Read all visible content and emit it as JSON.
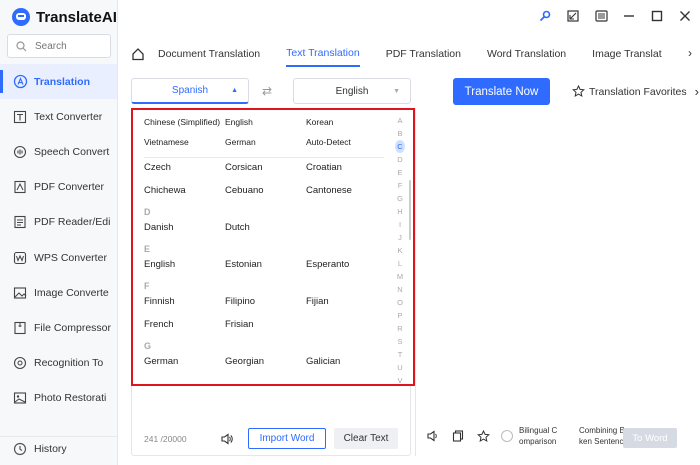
{
  "app": {
    "name": "TranslateAI"
  },
  "search": {
    "placeholder": "Search"
  },
  "sidebar": {
    "items": [
      {
        "label": "Translation",
        "icon": "translate-icon",
        "active": true
      },
      {
        "label": "Text Converter",
        "icon": "text-converter-icon"
      },
      {
        "label": "Speech Convert",
        "icon": "speech-icon"
      },
      {
        "label": "PDF Converter",
        "icon": "pdf-icon"
      },
      {
        "label": "PDF Reader/Edi",
        "icon": "pdf-reader-icon"
      },
      {
        "label": "WPS Converter",
        "icon": "wps-icon"
      },
      {
        "label": "Image Converte",
        "icon": "image-icon"
      },
      {
        "label": "File Compressor",
        "icon": "compress-icon"
      },
      {
        "label": "Recognition To",
        "icon": "recognition-icon"
      },
      {
        "label": "Photo Restorati",
        "icon": "photo-restore-icon"
      }
    ],
    "history": "History"
  },
  "tabs": [
    "Document Translation",
    "Text Translation",
    "PDF Translation",
    "Word Translation",
    "Image Translat"
  ],
  "active_tab": "Text Translation",
  "source_language": "Spanish",
  "target_language": "English",
  "translate_button": "Translate Now",
  "favorites": "Translation Favorites",
  "char_count": "241 /20000",
  "import_word": "Import Word",
  "clear_text": "Clear Text",
  "bilingual": "Bilingual C omparison",
  "combining": "Combining Bro ken Sentences",
  "to_word": "To Word",
  "dropdown": {
    "top_rows": [
      [
        "Chinese (Simplified)",
        "English",
        "Korean"
      ],
      [
        "Vietnamese",
        "German",
        "Auto-Detect"
      ]
    ],
    "c_rows": [
      [
        "Czech",
        "Corsican",
        "Croatian"
      ],
      [
        "Chichewa",
        "Cebuano",
        "Cantonese"
      ]
    ],
    "d_head": "D",
    "d_rows": [
      [
        "Danish",
        "Dutch",
        ""
      ]
    ],
    "e_head": "E",
    "e_rows": [
      [
        "English",
        "Estonian",
        "Esperanto"
      ]
    ],
    "f_head": "F",
    "f_rows": [
      [
        "Finnish",
        "Filipino",
        "Fijian"
      ],
      [
        "French",
        "Frisian",
        ""
      ]
    ],
    "g_head": "G",
    "g_rows": [
      [
        "German",
        "Georgian",
        "Galician"
      ]
    ],
    "alphabet": [
      "A",
      "B",
      "C",
      "D",
      "E",
      "F",
      "G",
      "H",
      "I",
      "J",
      "K",
      "L",
      "M",
      "N",
      "O",
      "P",
      "R",
      "S",
      "T",
      "U",
      "V",
      "W"
    ],
    "active_letter": "C"
  },
  "colors": {
    "accent": "#2f6bff",
    "highlight_border": "#e0141e"
  }
}
